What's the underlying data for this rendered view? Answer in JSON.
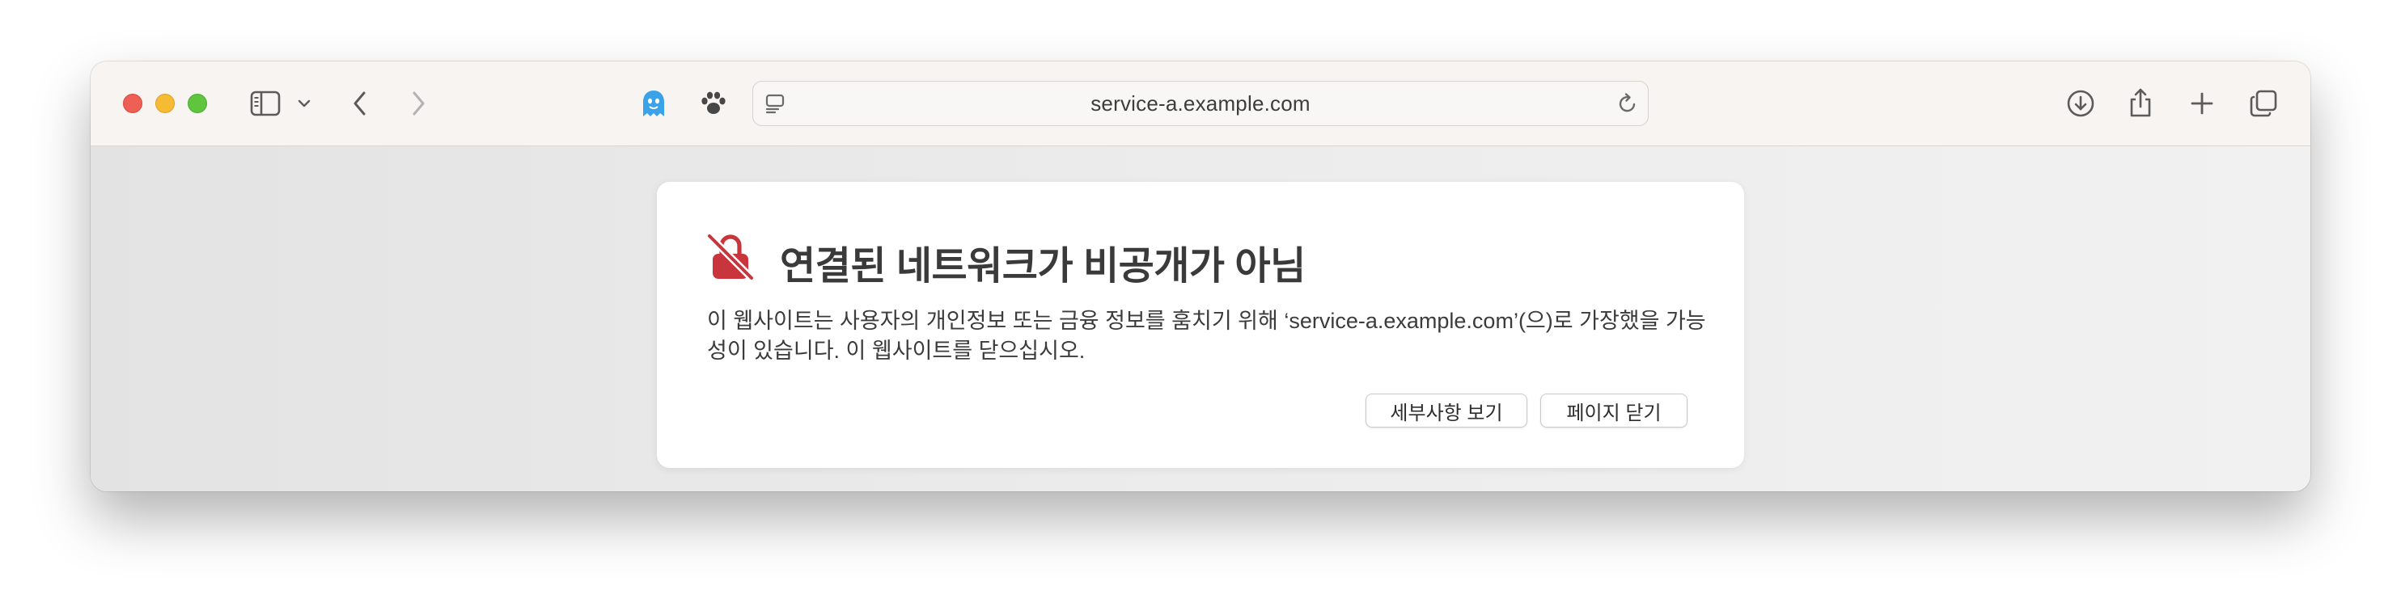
{
  "toolbar": {
    "url": "service-a.example.com",
    "icons": {
      "sidebar": "sidebar-icon",
      "sidebar_menu": "chevron-down-icon",
      "back": "chevron-left-icon",
      "forward": "chevron-right-icon",
      "extension_1": "ghost-icon",
      "extension_2": "paw-icon",
      "reader": "reader-icon",
      "reload": "reload-icon",
      "downloads": "download-icon",
      "share": "share-icon",
      "new_tab": "plus-icon",
      "tab_overview": "tabs-overview-icon"
    }
  },
  "dialog": {
    "icon": "broken-lock-icon",
    "title": "연결된 네트워크가 비공개가 아님",
    "message": "이 웹사이트는 사용자의 개인정보 또는 금융 정보를 훔치기 위해 ‘service-a.example.com’(으)로 가장했을 가능성이 있습니다. 이 웹사이트를 닫으십시오.",
    "details_button": "세부사항 보기",
    "close_button": "페이지 닫기"
  },
  "colors": {
    "warning_red": "#c9353d",
    "ghost_blue": "#3aa2e8",
    "toolbar_bg": "#f8f4f1"
  }
}
